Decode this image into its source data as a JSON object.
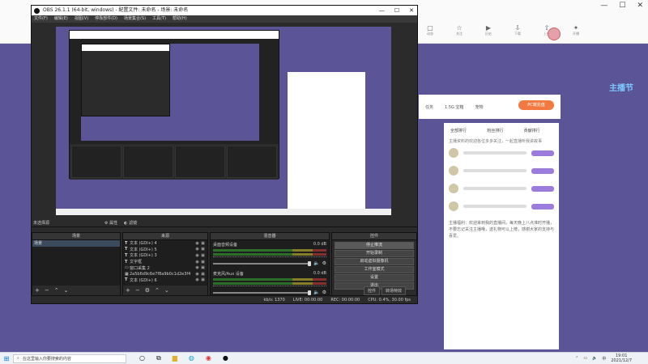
{
  "browser": {
    "nav_icons": [
      {
        "icon": "calendar-icon",
        "label": "动态"
      },
      {
        "icon": "star-icon",
        "label": "关注"
      },
      {
        "icon": "video-icon",
        "label": "历史"
      },
      {
        "icon": "download-icon",
        "label": "下载"
      },
      {
        "icon": "upload-icon",
        "label": "上传"
      },
      {
        "icon": "gift-icon",
        "label": "开播"
      }
    ],
    "gift_buttons": [
      "任务",
      "1.5G 宝箱",
      "宠物"
    ],
    "charge_label": "PC端充值",
    "side_logo": "主播节",
    "panel_tabs": [
      "全部排行",
      "粉丝排行",
      "贡献排行"
    ],
    "panel_notice": "主播资料的欢迎各位多多关注，一起直播听我讲故事",
    "panel_text": "主播福利：欢迎来到我的直播间，每天晚上八点准时开播，不要忘记关注主播哦，送礼物可以上榜，感谢大家的支持与喜爱。"
  },
  "obs": {
    "title": "OBS 26.1.1 (64-bit, windows) - 配置文件: 未命名 - 场景: 未命名",
    "menu": [
      "文件(F)",
      "编辑(E)",
      "视图(V)",
      "停靠部件(D)",
      "场景集合(S)",
      "工具(T)",
      "帮助(H)"
    ],
    "source_toolbar": {
      "no_source": "未选择源",
      "properties": "属性",
      "filters": "滤镜"
    },
    "docks": {
      "scenes": {
        "title": "场景",
        "items": [
          "场景"
        ]
      },
      "sources": {
        "title": "来源",
        "items": [
          {
            "type": "T",
            "label": "文本 (GDI+) 4"
          },
          {
            "type": "T",
            "label": "文本 (GDI+) 5"
          },
          {
            "type": "T",
            "label": "文本 (GDI+) 3"
          },
          {
            "type": "T",
            "label": "文字框"
          },
          {
            "type": "▭",
            "label": "窗口采集 2"
          },
          {
            "type": "▦",
            "label": "2a5b6d9c6e7f8a9b0c1d2e3f4"
          },
          {
            "type": "T",
            "label": "文本 (GDI+) 6"
          }
        ]
      },
      "mixer": {
        "title": "混音器",
        "channels": [
          {
            "name": "桌面音频设备",
            "db": "0.0 dB"
          },
          {
            "name": "麦克风/Aux 设备",
            "db": "0.0 dB"
          }
        ]
      },
      "controls": {
        "title": "控件",
        "buttons": [
          "停止推流",
          "开始录制",
          "启动虚拟摄像机",
          "工作室模式",
          "设置",
          "退出"
        ]
      }
    },
    "dock_tabs": [
      "控件",
      "转场特效"
    ],
    "status": {
      "live": "LIVE: 00:00:00",
      "rec": "REC: 00:00:00",
      "cpu": "CPU: 0.4%, 30.00 fps",
      "kbps": "kb/s: 1370"
    }
  },
  "taskbar": {
    "search_placeholder": "在这里输入你要搜索的内容",
    "time": "19:01",
    "date": "2021/12/7",
    "lang": "中"
  }
}
